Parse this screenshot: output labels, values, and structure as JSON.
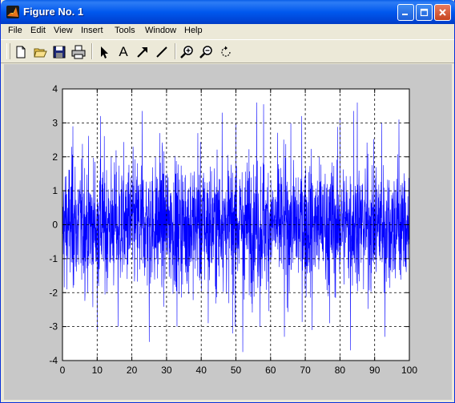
{
  "window": {
    "title": "Figure No. 1"
  },
  "menu": [
    "File",
    "Edit",
    "View",
    "Insert",
    "Tools",
    "Window",
    "Help"
  ],
  "toolbar": {
    "tools": [
      {
        "name": "new-figure-icon"
      },
      {
        "name": "open-file-icon"
      },
      {
        "name": "save-icon"
      },
      {
        "name": "print-icon"
      },
      {
        "name": "edit-plot-arrow-icon"
      },
      {
        "name": "insert-text-icon"
      },
      {
        "name": "insert-arrow-icon"
      },
      {
        "name": "insert-line-icon"
      },
      {
        "name": "zoom-in-icon"
      },
      {
        "name": "zoom-out-icon"
      },
      {
        "name": "rotate-3d-icon"
      }
    ],
    "text_tool_glyph": "A"
  },
  "colors": {
    "line": "#0000ff",
    "figure_bg": "#c8c8c8",
    "axes_bg": "#ffffff"
  },
  "chart_data": {
    "type": "line",
    "title": "",
    "xlabel": "",
    "ylabel": "",
    "xlim": [
      0,
      100
    ],
    "ylim": [
      -4,
      4
    ],
    "xticks": [
      0,
      10,
      20,
      30,
      40,
      50,
      60,
      70,
      80,
      90,
      100
    ],
    "yticks": [
      4,
      3,
      2,
      1,
      0,
      -1,
      -2,
      -3,
      -4
    ],
    "grid": "dashed",
    "series": [
      {
        "description_points": 2000,
        "noise_std": 0.95,
        "peaks": [
          {
            "x": 3,
            "y": 2.9
          },
          {
            "x": 11,
            "y": 3.2
          },
          {
            "x": 16,
            "y": 3.0
          },
          {
            "x": 23,
            "y": 3.35
          },
          {
            "x": 28,
            "y": 2.7
          },
          {
            "x": 39,
            "y": 2.7
          },
          {
            "x": 46,
            "y": 3.3
          },
          {
            "x": 50,
            "y": 3.0
          },
          {
            "x": 56,
            "y": 3.6
          },
          {
            "x": 58,
            "y": 3.55
          },
          {
            "x": 69,
            "y": 3.2
          },
          {
            "x": 80,
            "y": 3.15
          },
          {
            "x": 84,
            "y": 3.35
          },
          {
            "x": 85,
            "y": 3.6
          },
          {
            "x": 92,
            "y": 3.0
          },
          {
            "x": 97,
            "y": 3.1
          }
        ],
        "troughs": [
          {
            "x": 10,
            "y": -3.1
          },
          {
            "x": 16,
            "y": -3.0
          },
          {
            "x": 25,
            "y": -3.45
          },
          {
            "x": 33,
            "y": -3.0
          },
          {
            "x": 42,
            "y": -2.9
          },
          {
            "x": 49,
            "y": -3.2
          },
          {
            "x": 52,
            "y": -3.75
          },
          {
            "x": 57,
            "y": -3.0
          },
          {
            "x": 64,
            "y": -3.3
          },
          {
            "x": 72,
            "y": -3.1
          },
          {
            "x": 77,
            "y": -2.9
          },
          {
            "x": 83,
            "y": -3.7
          },
          {
            "x": 93,
            "y": -3.3
          }
        ]
      }
    ]
  }
}
